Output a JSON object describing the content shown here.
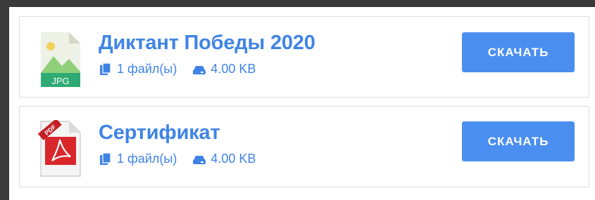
{
  "files": [
    {
      "title": "Диктант Победы 2020",
      "icon": "jpg-file-icon",
      "thumb_label": "JPG",
      "count_text": "1 файл(ы)",
      "size_text": "4.00 KB",
      "button_label": "СКАЧАТЬ"
    },
    {
      "title": "Сертификат",
      "icon": "pdf-file-icon",
      "thumb_label": "PDF",
      "count_text": "1 файл(ы)",
      "size_text": "4.00 KB",
      "button_label": "СКАЧАТЬ"
    }
  ],
  "colors": {
    "accent": "#3f84e5",
    "button": "#4a8ef0",
    "background": "#3a3a3a"
  }
}
